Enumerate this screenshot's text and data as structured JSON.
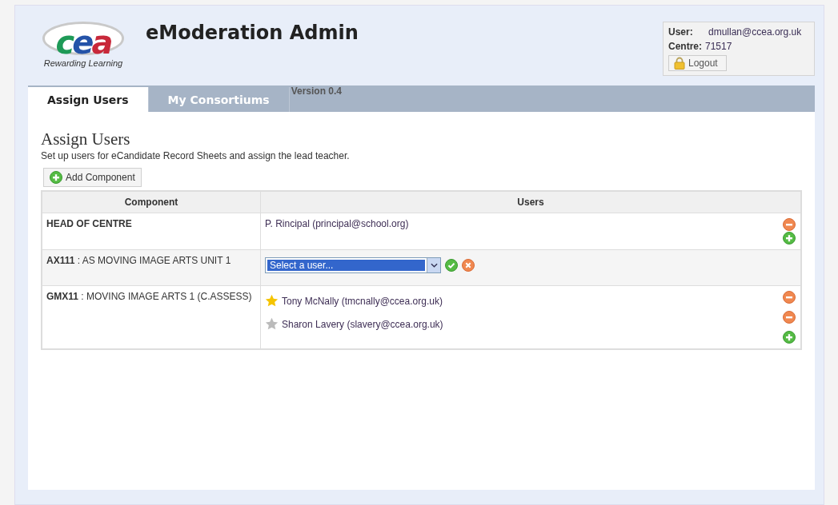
{
  "header": {
    "logo": {
      "letters": [
        {
          "text": "c",
          "color": "#1e9a57"
        },
        {
          "text": "e",
          "color": "#2453a8"
        },
        {
          "text": "a",
          "color": "#c8283a"
        }
      ],
      "tagline": "Rewarding Learning"
    },
    "title": "eModeration Admin"
  },
  "user_box": {
    "user_label": "User:",
    "user": "dmullan@ccea.org.uk",
    "centre_label": "Centre:",
    "centre": "71517",
    "logout": "Logout"
  },
  "tabs": [
    {
      "label": "Assign Users",
      "selected": true
    },
    {
      "label": "My Consortiums",
      "selected": false
    }
  ],
  "version": "Version 0.4",
  "page": {
    "heading": "Assign Users",
    "description": "Set up users for eCandidate Record Sheets and assign the lead teacher.",
    "add_button": "Add Component"
  },
  "table": {
    "columns": [
      "Component",
      "Users"
    ],
    "rows": [
      {
        "kind": "users",
        "component": "**HEAD OF CENTRE**",
        "users": [
          {
            "text": "P. Rincipal (principal@school.org)",
            "kind": "plain"
          }
        ]
      },
      {
        "kind": "select",
        "component": "**AX111** : AS MOVING IMAGE ARTS UNIT 1",
        "placeholder": "Select a user..."
      },
      {
        "kind": "users",
        "component": "**GMX11** : MOVING IMAGE ARTS 1 (C.ASSESS)",
        "users": [
          {
            "text": "Tony McNally (tmcnally@ccea.org.uk)",
            "kind": "starred",
            "lead": true
          },
          {
            "text": "Sharon Lavery (slavery@ccea.org.uk)",
            "kind": "starred",
            "lead": false
          }
        ]
      }
    ]
  }
}
